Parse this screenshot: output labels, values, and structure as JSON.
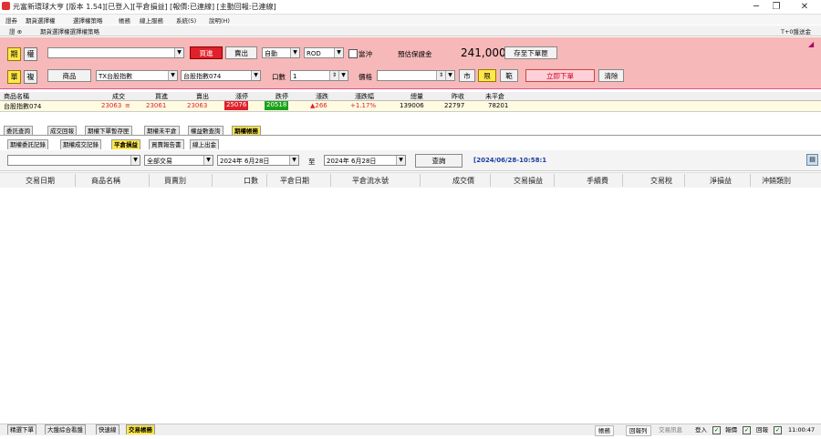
{
  "window": {
    "title": "元富新環球大亨 [版本 1.54][已登入][平倉損益] [報價:已連線] [主動回報:已連線]",
    "minimize": "─",
    "maximize": "❐",
    "close": "✕"
  },
  "menu": [
    "證券",
    "期貨選擇權",
    "選擇權策略",
    "帳務",
    "線上服務",
    "系統(S)",
    "說明(H)"
  ],
  "toolline": {
    "left": "證  ⊕",
    "label": "期貨選擇權選擇權策略",
    "right": "T+0盤送金"
  },
  "order": {
    "row1": {
      "fut": "期",
      "opt": "權",
      "symbol_value": "",
      "buy": "買進",
      "sell": "賣出",
      "auto": "自動",
      "rod": "ROD",
      "daytrade": "當沖",
      "margin_label": "預估保證金",
      "margin_value": "241,000",
      "save_btn": "存至下單匣"
    },
    "row2": {
      "single": "單",
      "combo": "複",
      "product_btn": "商品",
      "product_value": "TX台股指數",
      "contract_value": "台股指數074",
      "qty_label": "口數",
      "qty_value": "1",
      "price_label": "價格",
      "price_value": "",
      "market": "市",
      "limit": "限",
      "range": "範",
      "submit": "立即下單",
      "clear": "清除"
    }
  },
  "quote": {
    "headers": [
      "商品名稱",
      "成交",
      "買進",
      "賣出",
      "漲停",
      "跌停",
      "漲跌",
      "漲跌幅",
      "總量",
      "昨收",
      "未平倉"
    ],
    "row": {
      "name": "台股指數074",
      "last": "23063",
      "last_mark": "≡",
      "bid": "23061",
      "ask": "23063",
      "limit_up": "25076",
      "limit_down": "20518",
      "change": "▲266",
      "pct": "+1.17%",
      "volume": "139006",
      "prev": "22797",
      "oi": "78201"
    },
    "colors": {
      "up": "#e0202a",
      "down": "#1aa31a"
    }
  },
  "tabs1": [
    "委託查詢",
    "成交回報",
    "期權下單暫存匣",
    "期權未平倉",
    "權益數查詢",
    "期權帳務"
  ],
  "tabs1_active": 5,
  "tabs2": [
    "期權委託記錄",
    "期權成交記錄",
    "平倉損益",
    "買賣報告書",
    "線上出金"
  ],
  "tabs2_active": 2,
  "query": {
    "account": "",
    "type": "全部交易",
    "from": "2024年 6月28日",
    "to_label": "至",
    "to": "2024年 6月28日",
    "btn": "查詢",
    "timestamp": "[2024/06/28-10:58:1"
  },
  "grid": {
    "columns": [
      "交易日期",
      "商品名稱",
      "買賣別",
      "口數",
      "平倉日期",
      "平倉流水號",
      "成交價",
      "交易損益",
      "手續費",
      "交易稅",
      "淨損益",
      "沖銷類別"
    ]
  },
  "bottom_tabs": [
    "精選下單",
    "大盤綜合看盤",
    "快速線",
    "交易帳務"
  ],
  "bottom_active": 3,
  "status": {
    "items": [
      "帳務",
      "回報列",
      "交易訊息",
      "登入",
      "報價",
      "回報"
    ],
    "time": "11:00:47"
  }
}
